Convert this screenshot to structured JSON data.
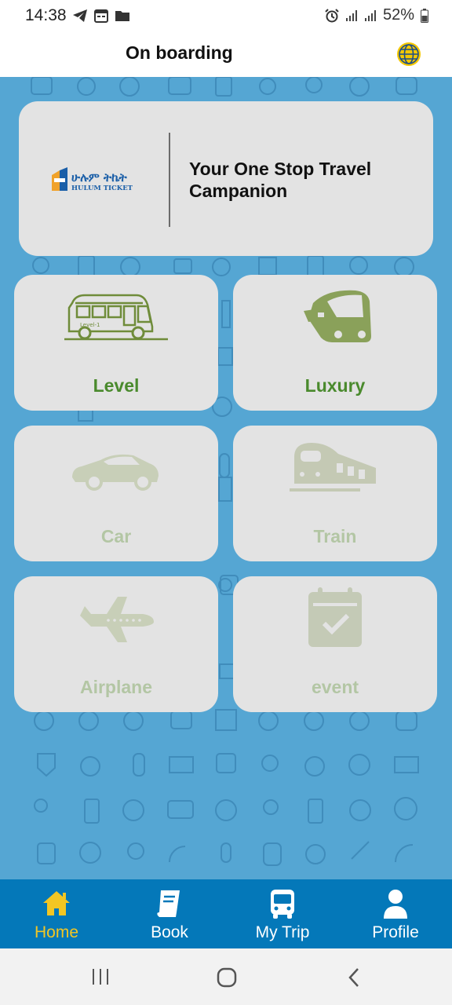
{
  "status_bar": {
    "time": "14:38",
    "battery": "52%",
    "icons": [
      "telegram-icon",
      "calendar-icon",
      "folder-icon",
      "alarm-icon",
      "signal-icon",
      "signal-icon",
      "battery-icon"
    ]
  },
  "app_bar": {
    "title": "On boarding",
    "language_icon": "globe-icon"
  },
  "hero": {
    "logo_text": "ሁሉም ትኬት",
    "logo_subtext": "HULUM TICKET",
    "tagline": "Your One Stop Travel Campanion"
  },
  "services": [
    {
      "label": "Level",
      "icon": "bus-icon",
      "bus_sign": "Level-1",
      "state": "active"
    },
    {
      "label": "Luxury",
      "icon": "coach-bus-icon",
      "state": "active"
    },
    {
      "label": "Car",
      "icon": "car-icon",
      "state": "inactive"
    },
    {
      "label": "Train",
      "icon": "train-icon",
      "state": "inactive"
    },
    {
      "label": "Airplane",
      "icon": "airplane-icon",
      "state": "inactive"
    },
    {
      "label": "event",
      "icon": "calendar-check-icon",
      "state": "inactive"
    }
  ],
  "bottom_nav": [
    {
      "label": "Home",
      "icon": "home-icon",
      "active": true
    },
    {
      "label": "Book",
      "icon": "book-icon",
      "active": false
    },
    {
      "label": "My Trip",
      "icon": "bus-front-icon",
      "active": false
    },
    {
      "label": "Profile",
      "icon": "person-icon",
      "active": false
    }
  ],
  "colors": {
    "background_blue": "#55a6d3",
    "nav_blue": "#0478b9",
    "active_green": "#4a8a2d",
    "inactive_green": "#b3c6a4",
    "nav_active_yellow": "#f3c623",
    "card_gray": "#e3e3e3"
  },
  "system_nav": [
    "recent-apps-icon",
    "home-circle-icon",
    "back-icon"
  ]
}
